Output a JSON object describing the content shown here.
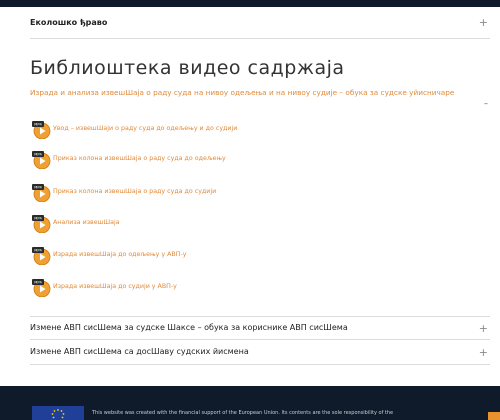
{
  "accordion_top": {
    "label": "Еколошко ђраво"
  },
  "page_title": "Библиоштека видео садржаја",
  "section": {
    "subtitle": "Израда и анализа извешШаја о раду суда на нивоу одељења и на нивоу судије – обука за судске уйисничаре",
    "collapse_symbol": "–"
  },
  "videos": [
    {
      "label": "Увод – извешШаји о раду суда до одељењу и до судији"
    },
    {
      "label": "Приказ колона извешШаја о раду суда до одељењу"
    },
    {
      "label": "Приказ колона извешШаја о раду суда до судији"
    },
    {
      "label": "Анализа извешШаја"
    },
    {
      "label": "Израда извешШаја до одељењу у АВП-у"
    },
    {
      "label": "Израда извешШаја до судији у АВП-у"
    }
  ],
  "video_icon_badge": "MP4",
  "accordion_bottom": [
    {
      "label": "Измене АВП сисШема за судске Шаксе – обука за кориснике АВП сисШема"
    },
    {
      "label": "Измене АВП сисШема са досШаву судских йисмена"
    }
  ],
  "expand_symbol": "+",
  "footer": {
    "text": "This website was created with the financial support of the European Union. Its contents are the sole responsibility of the"
  },
  "colors": {
    "accent": "#e08a3a",
    "footer_bg": "#0f1a2a",
    "eu_blue": "#1f3f99"
  }
}
